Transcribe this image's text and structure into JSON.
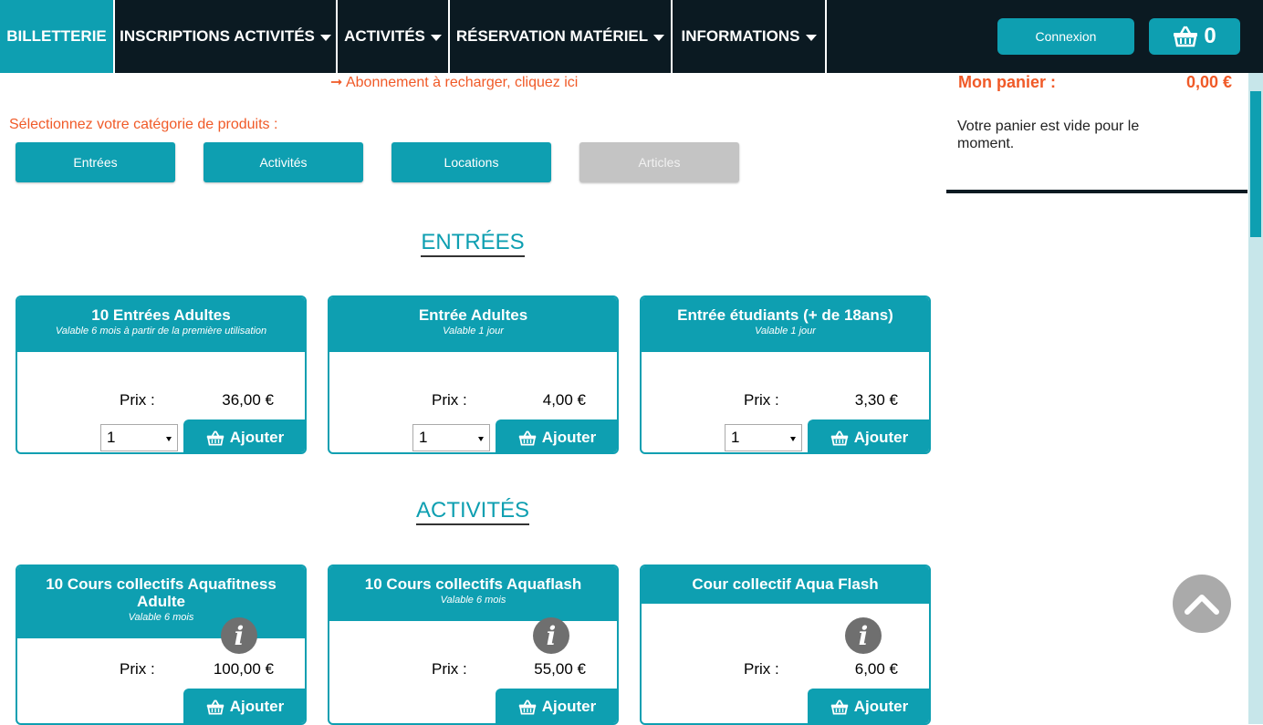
{
  "nav": {
    "items": [
      {
        "label": "BILLETTERIE"
      },
      {
        "label": "INSCRIPTIONS ACTIVITÉS"
      },
      {
        "label": "ACTIVITÉS"
      },
      {
        "label": "RÉSERVATION MATÉRIEL"
      },
      {
        "label": "INFORMATIONS"
      }
    ],
    "connexion_label": "Connexion",
    "cart_count": "0"
  },
  "notice": {
    "abonnement_link": "➞ Abonnement à recharger, cliquez ici"
  },
  "categories": {
    "prompt": "Sélectionnez votre catégorie de produits :",
    "buttons": [
      {
        "label": "Entrées"
      },
      {
        "label": "Activités"
      },
      {
        "label": "Locations"
      },
      {
        "label": "Articles"
      }
    ]
  },
  "sections": {
    "entrees": {
      "title": "ENTRÉES",
      "products": [
        {
          "title": "10 Entrées Adultes",
          "subtitle": "Valable 6 mois à partir de la première utilisation",
          "price_label": "Prix :",
          "price": "36,00 €",
          "qty": "1",
          "add_label": "Ajouter"
        },
        {
          "title": "Entrée Adultes",
          "subtitle": "Valable 1 jour",
          "price_label": "Prix :",
          "price": "4,00 €",
          "qty": "1",
          "add_label": "Ajouter"
        },
        {
          "title": "Entrée étudiants (+ de 18ans)",
          "subtitle": "Valable 1 jour",
          "price_label": "Prix :",
          "price": "3,30 €",
          "qty": "1",
          "add_label": "Ajouter"
        }
      ]
    },
    "activites": {
      "title": "ACTIVITÉS",
      "products": [
        {
          "title_line1": "10 Cours collectifs Aquafitness",
          "title_line2": "Adulte",
          "subtitle": "Valable 6 mois",
          "price_label": "Prix :",
          "price": "100,00 €",
          "add_label": "Ajouter"
        },
        {
          "title_line1": "10 Cours collectifs Aquaflash",
          "subtitle": "Valable 6 mois",
          "price_label": "Prix :",
          "price": "55,00 €",
          "add_label": "Ajouter"
        },
        {
          "title_line1": "Cour collectif Aqua Flash",
          "price_label": "Prix :",
          "price": "6,00 €",
          "add_label": "Ajouter"
        }
      ]
    }
  },
  "cart": {
    "title": "Mon panier :",
    "total": "0,00 €",
    "empty_message": "Votre panier est vide pour le moment."
  },
  "colors": {
    "accent": "#0e9fb1",
    "navbar": "#0b1a22",
    "orange": "#f05a28",
    "disabled": "#c4c4c4"
  },
  "icons": {
    "cart": "basket-icon",
    "info": "info-icon",
    "back_to_top": "chevron-up-icon",
    "dropdown": "caret-down-icon"
  }
}
